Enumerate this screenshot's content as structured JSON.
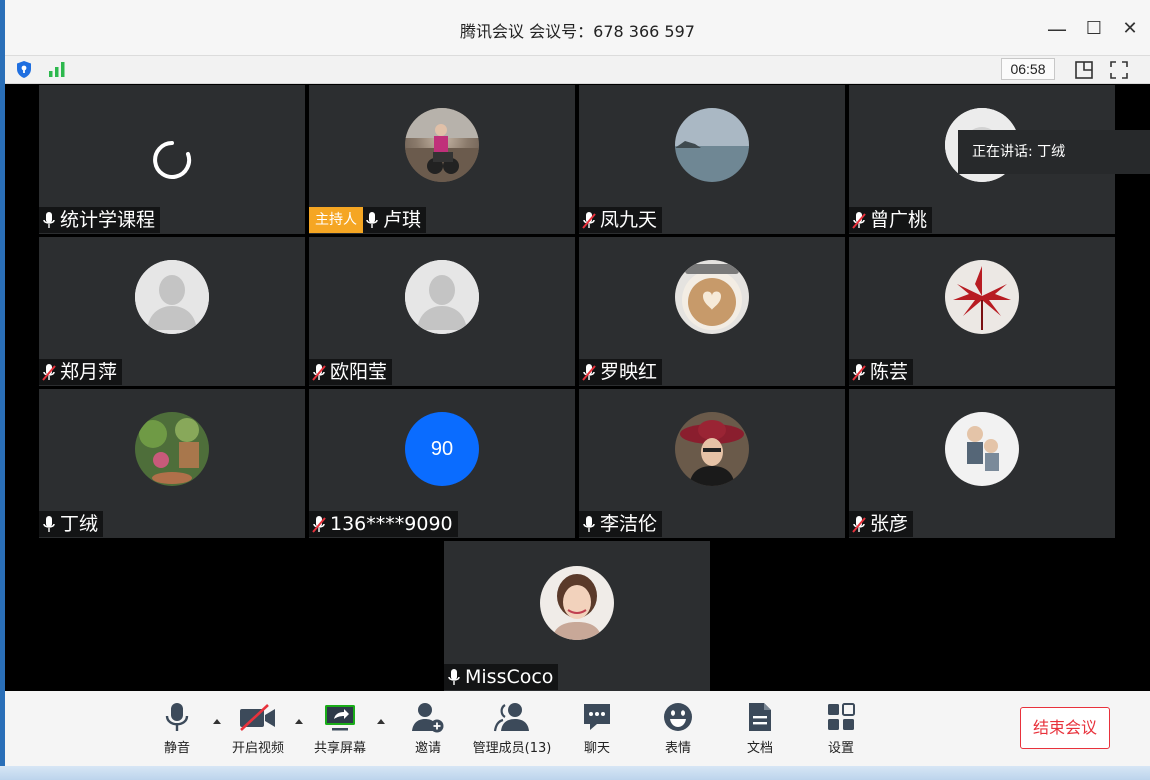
{
  "window": {
    "title": "腾讯会议 会议号：678 366 597",
    "minimize": "—",
    "maximize": "☐",
    "close": "✕"
  },
  "status": {
    "elapsed_time": "06:58",
    "shield_icon": "shield-icon",
    "signal_icon": "signal-icon"
  },
  "speaking_notice": "正在讲话: 丁绒",
  "participants": [
    {
      "name": "统计学课程",
      "mic": "on",
      "avatar": "loading"
    },
    {
      "name": "卢琪",
      "mic": "on",
      "host_badge": "主持人",
      "avatar": "photo"
    },
    {
      "name": "凤九天",
      "mic": "muted",
      "avatar": "photo"
    },
    {
      "name": "曾广桃",
      "mic": "muted",
      "avatar": "photo"
    },
    {
      "name": "郑月萍",
      "mic": "muted",
      "avatar": "default"
    },
    {
      "name": "欧阳莹",
      "mic": "muted",
      "avatar": "default"
    },
    {
      "name": "罗映红",
      "mic": "muted",
      "avatar": "photo"
    },
    {
      "name": "陈芸",
      "mic": "muted",
      "avatar": "photo"
    },
    {
      "name": "丁绒",
      "mic": "on",
      "avatar": "photo"
    },
    {
      "name": "136****9090",
      "mic": "muted",
      "avatar_text": "90"
    },
    {
      "name": "李洁伦",
      "mic": "on",
      "avatar": "photo"
    },
    {
      "name": "张彦",
      "mic": "muted",
      "avatar": "photo"
    },
    {
      "name": "MissCoco",
      "mic": "on",
      "avatar": "photo"
    }
  ],
  "toolbar": {
    "mute": "静音",
    "video": "开启视频",
    "share": "共享屏幕",
    "invite": "邀请",
    "members": "管理成员(13)",
    "chat": "聊天",
    "emoji": "表情",
    "docs": "文档",
    "settings": "设置",
    "end": "结束会议"
  },
  "colors": {
    "host_badge": "#f5a623",
    "end_button": "#e8323c",
    "signal": "#2db84d",
    "share_green": "#1aad19",
    "number_avatar": "#0a6cff"
  }
}
